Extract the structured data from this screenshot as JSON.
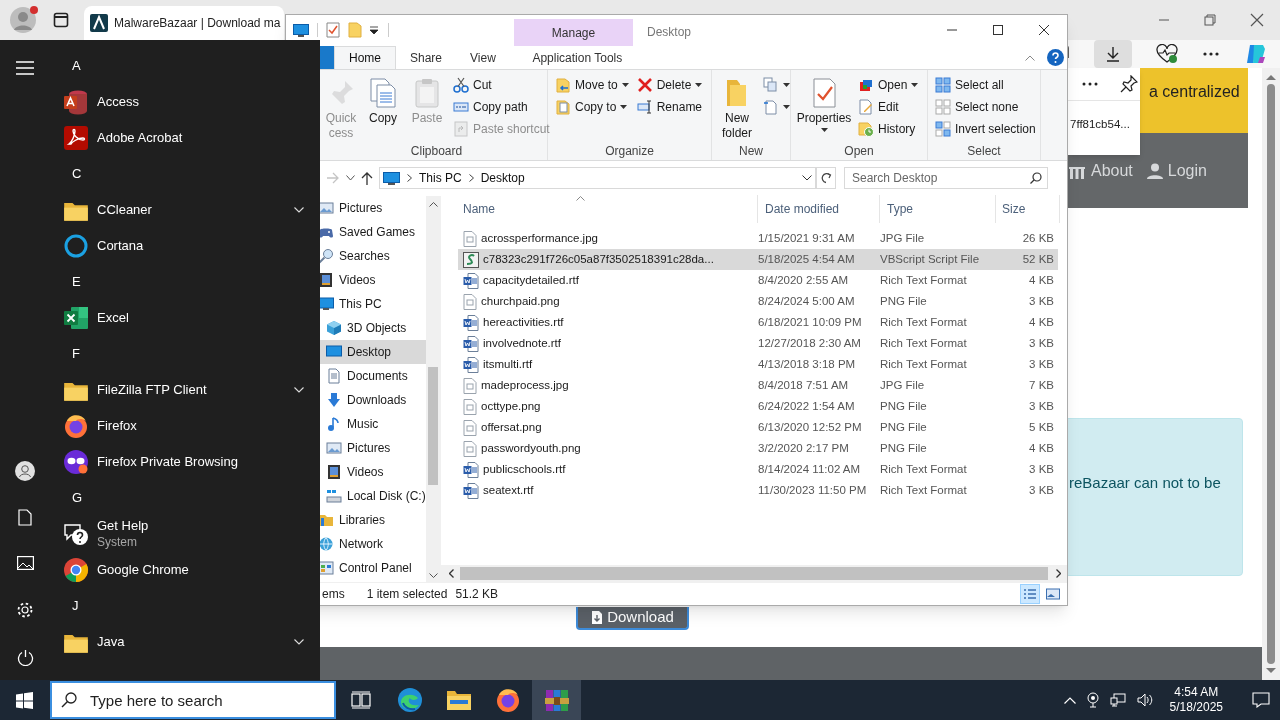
{
  "browser": {
    "tab": {
      "title": "MalwareBazaar | Download ma",
      "selected": true
    },
    "download_panel": {
      "file_text": "7ff81cb54..."
    },
    "page": {
      "banner_text": "a centralized",
      "nav": [
        {
          "label": "About",
          "kind": "about"
        },
        {
          "label": "Login",
          "kind": "login"
        }
      ],
      "notice_text": "reBazaar can not to be",
      "download_button": "Download"
    }
  },
  "start_menu": {
    "groups": [
      {
        "letter": "A",
        "apps": [
          {
            "name": "Access",
            "kind": "access"
          },
          {
            "name": "Adobe Acrobat",
            "kind": "acrobat"
          }
        ]
      },
      {
        "letter": "C",
        "apps": [
          {
            "name": "CCleaner",
            "kind": "folder"
          },
          {
            "name": "Cortana",
            "kind": "cortana"
          }
        ]
      },
      {
        "letter": "E",
        "apps": [
          {
            "name": "Excel",
            "kind": "excel"
          }
        ]
      },
      {
        "letter": "F",
        "apps": [
          {
            "name": "FileZilla FTP Client",
            "kind": "folder"
          },
          {
            "name": "Firefox",
            "kind": "firefox"
          },
          {
            "name": "Firefox Private Browsing",
            "kind": "firefox-private"
          }
        ]
      },
      {
        "letter": "G",
        "apps": [
          {
            "name": "Get Help",
            "kind": "help",
            "subtitle": "System"
          },
          {
            "name": "Google Chrome",
            "kind": "chrome"
          }
        ]
      },
      {
        "letter": "J",
        "apps": [
          {
            "name": "Java",
            "kind": "folder"
          }
        ]
      }
    ]
  },
  "explorer": {
    "title": "Desktop",
    "context_group": "Manage",
    "tabs": [
      {
        "label": "Home",
        "selected": true,
        "kind": "normal"
      },
      {
        "label": "Share",
        "selected": false,
        "kind": "normal"
      },
      {
        "label": "View",
        "selected": false,
        "kind": "normal"
      },
      {
        "label": "Application Tools",
        "selected": false,
        "kind": "context"
      }
    ],
    "groups": [
      {
        "label": "Clipboard",
        "columns": [
          {
            "kind": "large",
            "items": [
              {
                "kind": "pin",
                "label": "Quick cess",
                "disabled": true,
                "dropdown": false
              }
            ]
          },
          {
            "kind": "large",
            "items": [
              {
                "kind": "copy",
                "label": "Copy",
                "disabled": false,
                "dropdown": false
              }
            ]
          },
          {
            "kind": "large",
            "items": [
              {
                "kind": "paste",
                "label": "Paste",
                "disabled": true,
                "dropdown": false
              }
            ]
          },
          {
            "kind": "stack",
            "items": [
              {
                "kind": "cut",
                "label": "Cut",
                "disabled": false,
                "dropdown": false
              },
              {
                "kind": "copy-path",
                "label": "Copy path",
                "disabled": false,
                "dropdown": false
              },
              {
                "kind": "paste-shortcut",
                "label": "Paste shortcut",
                "disabled": true,
                "dropdown": false
              }
            ]
          }
        ]
      },
      {
        "label": "Organize",
        "columns": [
          {
            "kind": "stack",
            "items": [
              {
                "kind": "move",
                "label": "Move to",
                "disabled": false,
                "dropdown": true
              },
              {
                "kind": "copy-to",
                "label": "Copy to",
                "disabled": false,
                "dropdown": true
              }
            ]
          },
          {
            "kind": "stack",
            "items": [
              {
                "kind": "delete",
                "label": "Delete",
                "disabled": false,
                "dropdown": true
              },
              {
                "kind": "rename",
                "label": "Rename",
                "disabled": false,
                "dropdown": false
              }
            ]
          }
        ]
      },
      {
        "label": "New",
        "columns": [
          {
            "kind": "large",
            "items": [
              {
                "kind": "new-folder",
                "label": "New folder",
                "disabled": false,
                "dropdown": false
              }
            ]
          },
          {
            "kind": "stack",
            "items": [
              {
                "kind": "new-item",
                "disabled": false,
                "dropdown": true
              },
              {
                "kind": "easy-access",
                "disabled": false,
                "dropdown": true
              }
            ]
          }
        ]
      },
      {
        "label": "Open",
        "columns": [
          {
            "kind": "large",
            "items": [
              {
                "kind": "properties",
                "label": "Properties",
                "disabled": false,
                "dropdown": true
              }
            ]
          },
          {
            "kind": "stack",
            "items": [
              {
                "kind": "open",
                "label": "Open",
                "disabled": false,
                "dropdown": true
              },
              {
                "kind": "edit",
                "label": "Edit",
                "disabled": false,
                "dropdown": false
              },
              {
                "kind": "history",
                "label": "History",
                "disabled": false,
                "dropdown": false
              }
            ]
          }
        ]
      },
      {
        "label": "Select",
        "columns": [
          {
            "kind": "stack",
            "items": [
              {
                "kind": "select-all",
                "label": "Select all",
                "disabled": false,
                "dropdown": false
              },
              {
                "kind": "select-none",
                "label": "Select none",
                "disabled": false,
                "dropdown": false
              },
              {
                "kind": "invert",
                "label": "Invert selection",
                "disabled": false,
                "dropdown": false
              }
            ]
          }
        ]
      }
    ],
    "path": [
      "This PC",
      "Desktop"
    ],
    "search": {
      "placeholder": "Search Desktop"
    },
    "nav": [
      {
        "children": [
          {
            "label": "Pictures",
            "kind": "pictures",
            "selected": false
          },
          {
            "label": "Saved Games",
            "kind": "games",
            "selected": false
          },
          {
            "label": "Searches",
            "kind": "search",
            "selected": false
          },
          {
            "label": "Videos",
            "kind": "videos",
            "selected": false
          }
        ]
      },
      {
        "label": "This PC",
        "kind": "pc",
        "selected": false,
        "children": [
          {
            "label": "3D Objects",
            "kind": "objects",
            "selected": false
          },
          {
            "label": "Desktop",
            "kind": "desktop",
            "selected": true
          },
          {
            "label": "Documents",
            "kind": "documents",
            "selected": false
          },
          {
            "label": "Downloads",
            "kind": "downloads",
            "selected": false
          },
          {
            "label": "Music",
            "kind": "music",
            "selected": false
          },
          {
            "label": "Pictures",
            "kind": "pictures",
            "selected": false
          },
          {
            "label": "Videos",
            "kind": "videos",
            "selected": false
          },
          {
            "label": "Local Disk (C:)",
            "kind": "disk",
            "selected": false
          }
        ]
      },
      {
        "label": "Libraries",
        "kind": "libraries",
        "selected": false
      },
      {
        "label": "Network",
        "kind": "network",
        "selected": false
      },
      {
        "label": "Control Panel",
        "kind": "control",
        "selected": false
      }
    ],
    "columns": [
      {
        "label": "Name",
        "sorted": true
      },
      {
        "label": "Date modified",
        "sorted": false
      },
      {
        "label": "Type",
        "sorted": false
      },
      {
        "label": "Size",
        "sorted": false
      }
    ],
    "rows": [
      {
        "name": "acrossperformance.jpg",
        "date": "1/15/2021 9:31 AM",
        "type": "JPG File",
        "size": "26 KB",
        "kind": "image",
        "selected": false
      },
      {
        "name": "c78323c291f726c05a87f3502518391c28da...",
        "date": "5/18/2025 4:54 AM",
        "type": "VBScript Script File",
        "size": "52 KB",
        "kind": "script",
        "selected": true
      },
      {
        "name": "capacitydetailed.rtf",
        "date": "8/4/2020 2:55 AM",
        "type": "Rich Text Format",
        "size": "4 KB",
        "kind": "rtf",
        "selected": false
      },
      {
        "name": "churchpaid.png",
        "date": "8/24/2024 5:00 AM",
        "type": "PNG File",
        "size": "3 KB",
        "kind": "image",
        "selected": false
      },
      {
        "name": "hereactivities.rtf",
        "date": "6/18/2021 10:09 PM",
        "type": "Rich Text Format",
        "size": "4 KB",
        "kind": "rtf",
        "selected": false
      },
      {
        "name": "involvednote.rtf",
        "date": "12/27/2018 2:30 AM",
        "type": "Rich Text Format",
        "size": "3 KB",
        "kind": "rtf",
        "selected": false
      },
      {
        "name": "itsmulti.rtf",
        "date": "4/13/2018 3:18 PM",
        "type": "Rich Text Format",
        "size": "3 KB",
        "kind": "rtf",
        "selected": false
      },
      {
        "name": "madeprocess.jpg",
        "date": "8/4/2018 7:51 AM",
        "type": "JPG File",
        "size": "7 KB",
        "kind": "image",
        "selected": false
      },
      {
        "name": "octtype.png",
        "date": "6/24/2022 1:54 AM",
        "type": "PNG File",
        "size": "3 KB",
        "kind": "image",
        "selected": false
      },
      {
        "name": "offersat.png",
        "date": "6/13/2020 12:52 PM",
        "type": "PNG File",
        "size": "5 KB",
        "kind": "image",
        "selected": false
      },
      {
        "name": "passwordyouth.png",
        "date": "3/2/2020 2:17 PM",
        "type": "PNG File",
        "size": "4 KB",
        "kind": "image",
        "selected": false
      },
      {
        "name": "publicschools.rtf",
        "date": "8/14/2024 11:02 AM",
        "type": "Rich Text Format",
        "size": "3 KB",
        "kind": "rtf",
        "selected": false
      },
      {
        "name": "seatext.rtf",
        "date": "11/30/2023 11:50 PM",
        "type": "Rich Text Format",
        "size": "3 KB",
        "kind": "rtf",
        "selected": false
      }
    ],
    "status": {
      "count": "ems",
      "selection": "1 item selected",
      "size": "51.2 KB"
    },
    "views": [
      {
        "kind": "details",
        "selected": true
      },
      {
        "kind": "large-icons",
        "selected": false
      }
    ]
  },
  "taskbar": {
    "search_placeholder": "Type here to search",
    "apps": [
      {
        "kind": "task-view",
        "active": false
      },
      {
        "kind": "edge",
        "active": false
      },
      {
        "kind": "explorer",
        "active": false
      },
      {
        "kind": "firefox",
        "active": false
      },
      {
        "kind": "archiver",
        "active": true
      }
    ],
    "time": "4:54 AM",
    "date": "5/18/2025"
  }
}
